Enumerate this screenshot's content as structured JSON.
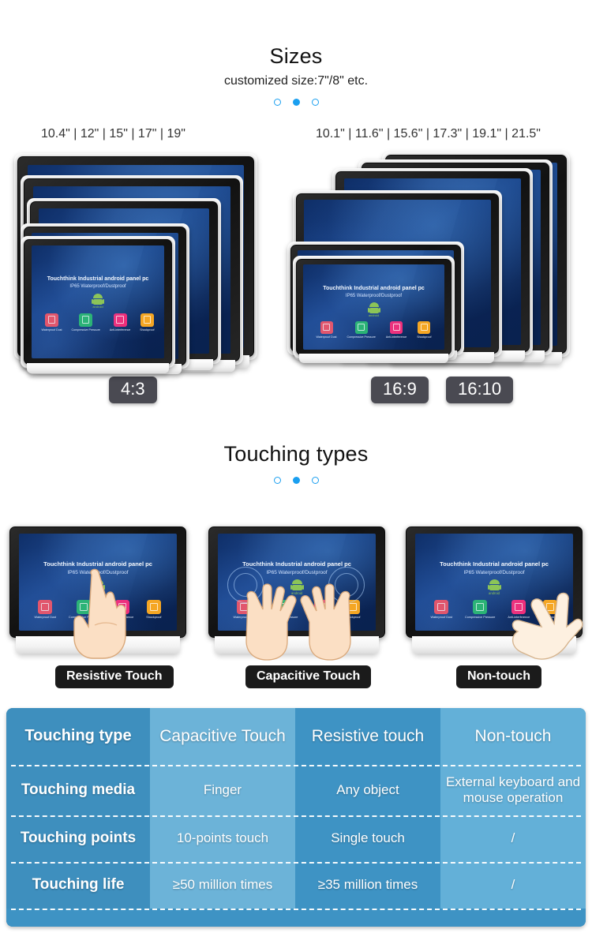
{
  "sizes_section": {
    "title": "Sizes",
    "subtitle": "customized size:7\"/8\" etc.",
    "left_group": {
      "sizes_text": "10.4\" | 12\" | 15\" | 17\" | 19\"",
      "sizes": [
        "10.4\"",
        "12\"",
        "15\"",
        "17\"",
        "19\""
      ],
      "ratio_badge": "4:3"
    },
    "right_group": {
      "sizes_text": "10.1\" | 11.6\" | 15.6\" | 17.3\" | 19.1\" | 21.5\"",
      "sizes": [
        "10.1\"",
        "11.6\"",
        "15.6\"",
        "17.3\"",
        "19.1\"",
        "21.5\""
      ],
      "ratio_badges": [
        "16:9",
        "16:10"
      ]
    }
  },
  "screen_ui": {
    "title": "Touchthink Industrial android panel pc",
    "subtitle": "IP65 Waterproof/Dustproof",
    "android_word": "android",
    "features": [
      {
        "label": "Waterproof Dust",
        "color": "#ef4a5a"
      },
      {
        "label": "Compressive Pressure",
        "color": "#25b36b"
      },
      {
        "label": "Anti-interference",
        "color": "#ef2e7a"
      },
      {
        "label": "Shockproof",
        "color": "#f5a623"
      }
    ]
  },
  "touching_section": {
    "title": "Touching types",
    "cards": [
      {
        "badge": "Resistive Touch"
      },
      {
        "badge": "Capacitive Touch"
      },
      {
        "badge": "Non-touch"
      }
    ]
  },
  "comparison_table": {
    "header": [
      "Touching type",
      "Capacitive Touch",
      "Resistive touch",
      "Non-touch"
    ],
    "rows": [
      {
        "label": "Touching media",
        "values": [
          "Finger",
          "Any object",
          "External keyboard and mouse operation"
        ]
      },
      {
        "label": "Touching points",
        "values": [
          "10-points touch",
          "Single touch",
          "/"
        ]
      },
      {
        "label": "Touching life",
        "values": [
          "≥50 million times",
          "≥35 million times",
          "/"
        ]
      }
    ],
    "colors": {
      "col1": "#3e8fbe",
      "col2": "#6cb3d8",
      "col3": "#3e93c4",
      "col4": "#63b0d8"
    }
  },
  "indicator_dots": {
    "total": 3,
    "active_index": 1
  }
}
